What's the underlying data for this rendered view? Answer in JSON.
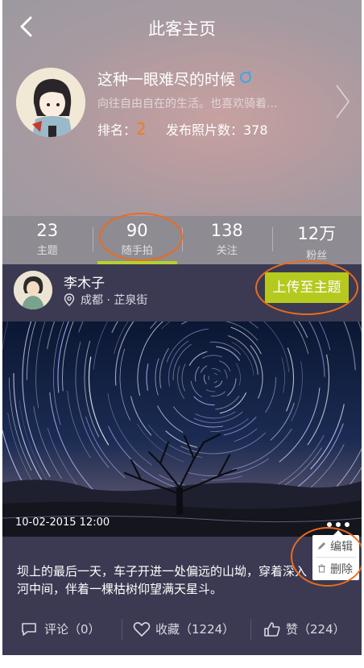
{
  "nav": {
    "title": "此客主页"
  },
  "profile": {
    "name": "这种一眼难尽的时候",
    "bio": "向往自由自在的生活。也喜欢骑着...",
    "rank_label": "排名：",
    "rank_value": "2",
    "photos_label": "发布照片数：",
    "photos_value": "378"
  },
  "tabs": [
    {
      "num": "23",
      "label": "主题"
    },
    {
      "num": "90",
      "label": "随手拍"
    },
    {
      "num": "138",
      "label": "关注"
    },
    {
      "num": "12万",
      "label": "粉丝"
    }
  ],
  "post": {
    "author": "李木子",
    "location": "成都 · 芷泉街",
    "upload_label": "上传至主题",
    "date": "10-02-2015  12:00",
    "description": "坝上的最后一天，车子开进一处偏远的山坳，穿着深入河中间，伴着一棵枯树仰望满天星斗。",
    "menu": {
      "edit": "编辑",
      "delete": "删除"
    },
    "actions": {
      "comment": "评论（0）",
      "favorite": "收藏（1224）",
      "like": "赞（224）"
    }
  },
  "colors": {
    "accent": "#b6c91e",
    "rank": "#f07a1e",
    "annotation": "#ec6b1c"
  },
  "icons": [
    "back-arrow-icon",
    "verified-icon",
    "chevron-right-icon",
    "location-pin-icon",
    "more-dots-icon",
    "pencil-icon",
    "trash-icon",
    "comment-icon",
    "heart-icon",
    "thumbs-up-icon"
  ]
}
